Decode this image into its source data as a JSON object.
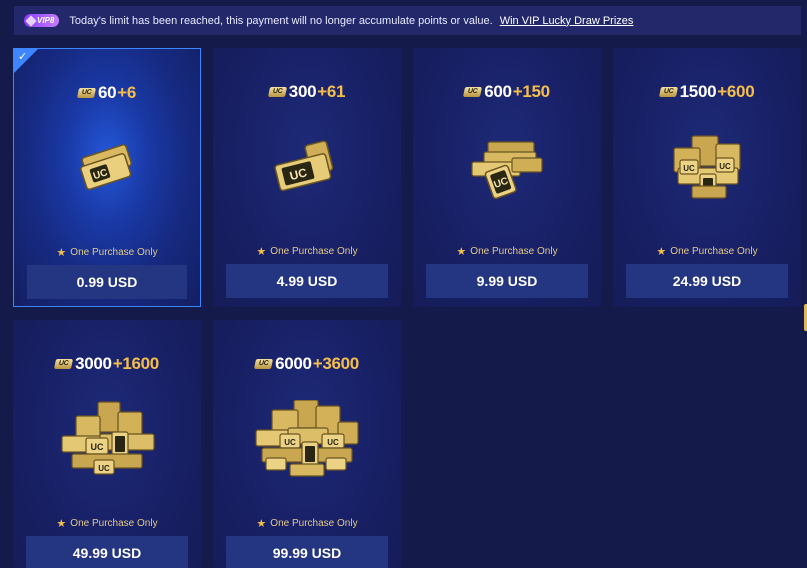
{
  "notice": {
    "vip_badge": "VIP8",
    "message": "Today's limit has been reached, this payment will no longer accumulate points or value.",
    "link": "Win VIP Lucky Draw Prizes"
  },
  "currency_icon_label": "UC",
  "colors": {
    "background": "#141a4a",
    "bonus": "#f5be4c",
    "selected_border": "#3d86ff",
    "price_button": "#243581"
  },
  "packages": [
    {
      "base": "60",
      "bonus": "+6",
      "limit": "One Purchase Only",
      "price": "0.99 USD",
      "selected": true
    },
    {
      "base": "300",
      "bonus": "+61",
      "limit": "One Purchase Only",
      "price": "4.99 USD",
      "selected": false
    },
    {
      "base": "600",
      "bonus": "+150",
      "limit": "One Purchase Only",
      "price": "9.99 USD",
      "selected": false
    },
    {
      "base": "1500",
      "bonus": "+600",
      "limit": "One Purchase Only",
      "price": "24.99 USD",
      "selected": false
    },
    {
      "base": "3000",
      "bonus": "+1600",
      "limit": "One Purchase Only",
      "price": "49.99 USD",
      "selected": false
    },
    {
      "base": "6000",
      "bonus": "+3600",
      "limit": "One Purchase Only",
      "price": "99.99 USD",
      "selected": false
    }
  ]
}
